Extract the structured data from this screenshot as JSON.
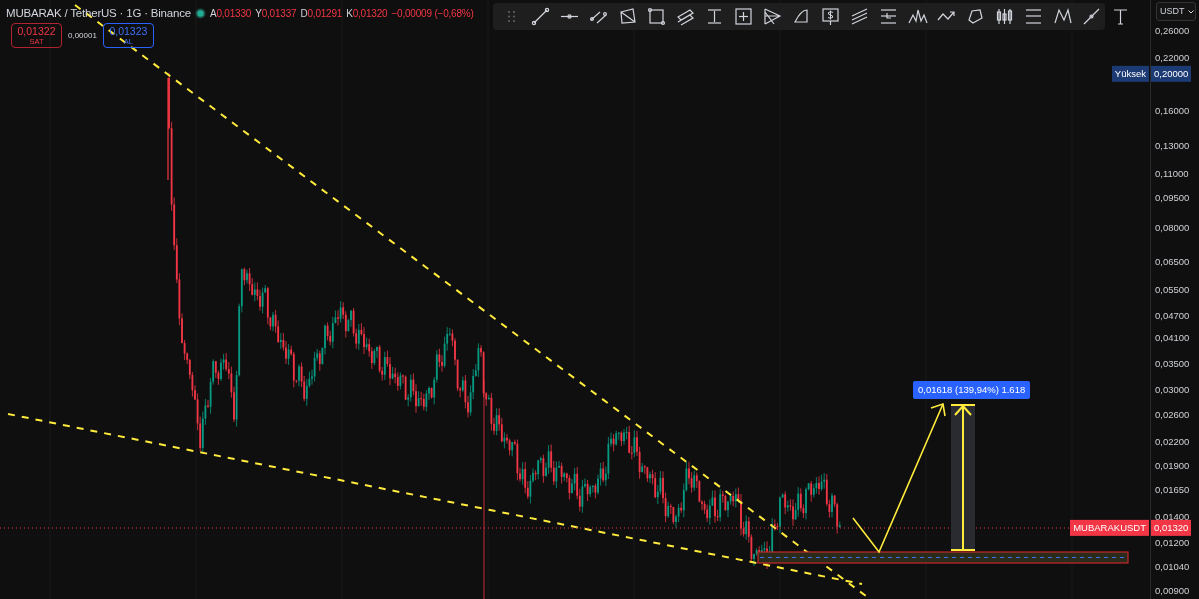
{
  "header": {
    "title": "MUBARAK / TetherUS · 1G · Binance",
    "market_open": true,
    "ohlc": [
      {
        "label": "A",
        "value": "0,01330"
      },
      {
        "label": "Y",
        "value": "0,01337"
      },
      {
        "label": "D",
        "value": "0,01291"
      },
      {
        "label": "K",
        "value": "0,01320"
      }
    ],
    "change": "−0,00009 (−0,68%)"
  },
  "trade": {
    "sell": {
      "price": "0,01322",
      "label": "SAT"
    },
    "spread": "0,00001",
    "buy": {
      "price": "0,01323",
      "label": "AL"
    }
  },
  "currency": "USDT",
  "price_axis": {
    "ticks": [
      "0,26000",
      "0,22000",
      "0,16000",
      "0,13000",
      "0,11000",
      "0,09500",
      "0,08000",
      "0,06500",
      "0,05500",
      "0,04700",
      "0,04100",
      "0,03500",
      "0,03000",
      "0,02600",
      "0,02200",
      "0,01900",
      "0,01650",
      "0,01400",
      "0,01200",
      "0,01040",
      "0,00900"
    ],
    "high": {
      "label": "Yüksek",
      "value": "0,20000"
    },
    "last": {
      "symbol": "MUBARAKUSDT",
      "value": "0,01320"
    }
  },
  "projection": {
    "label": "0,01618 (139,94%) 1.618"
  }
}
